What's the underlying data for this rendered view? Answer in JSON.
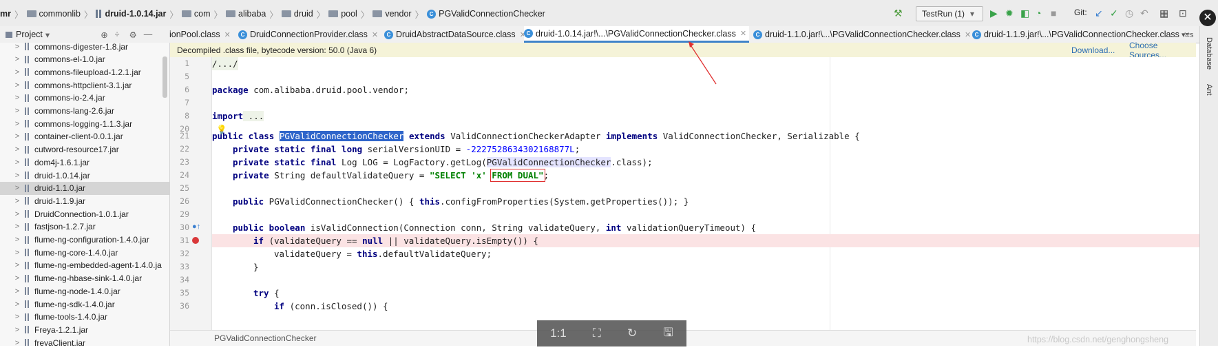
{
  "breadcrumb": [
    "mr",
    "commonlib",
    "druid-1.0.14.jar",
    "com",
    "alibaba",
    "druid",
    "pool",
    "vendor",
    "PGValidConnectionChecker"
  ],
  "toolbar": {
    "run_config": "TestRun (1)",
    "git_label": "Git:"
  },
  "project_header": {
    "label": "Project"
  },
  "tabs": [
    {
      "label": "ionPool.class",
      "active": false
    },
    {
      "label": "DruidConnectionProvider.class",
      "active": false
    },
    {
      "label": "DruidAbstractDataSource.class",
      "active": false
    },
    {
      "label": "druid-1.0.14.jar!\\...\\PGValidConnectionChecker.class",
      "active": true
    },
    {
      "label": "druid-1.1.0.jar!\\...\\PGValidConnectionChecker.class",
      "active": false
    },
    {
      "label": "druid-1.1.9.jar!\\...\\PGValidConnectionChecker.class",
      "active": false
    }
  ],
  "tabs_overflow": "▾≡s",
  "sidebar": {
    "items": [
      "commons-digester-1.8.jar",
      "commons-el-1.0.jar",
      "commons-fileupload-1.2.1.jar",
      "commons-httpclient-3.1.jar",
      "commons-io-2.4.jar",
      "commons-lang-2.6.jar",
      "commons-logging-1.1.3.jar",
      "container-client-0.0.1.jar",
      "cutword-resource17.jar",
      "dom4j-1.6.1.jar",
      "druid-1.0.14.jar",
      "druid-1.1.0.jar",
      "druid-1.1.9.jar",
      "DruidConnection-1.0.1.jar",
      "fastjson-1.2.7.jar",
      "flume-ng-configuration-1.4.0.jar",
      "flume-ng-core-1.4.0.jar",
      "flume-ng-embedded-agent-1.4.0.ja",
      "flume-ng-hbase-sink-1.4.0.jar",
      "flume-ng-node-1.4.0.jar",
      "flume-ng-sdk-1.4.0.jar",
      "flume-tools-1.4.0.jar",
      "Freya-1.2.1.jar",
      "freyaClient.jar"
    ],
    "selected": "druid-1.1.0.jar"
  },
  "infobar": {
    "message": "Decompiled .class file, bytecode version: 50.0 (Java 6)",
    "download": "Download...",
    "choose_sources": "Choose Sources..."
  },
  "code": {
    "line_numbers": [
      "1",
      "5",
      "6",
      "7",
      "8",
      "20",
      "21",
      "22",
      "23",
      "24",
      "25",
      "26",
      "29",
      "30",
      "31",
      "32",
      "33",
      "34",
      "35",
      "36"
    ],
    "l1": "/.../",
    "l6_kw": "package",
    "l6_rest": " com.alibaba.druid.pool.vendor;",
    "l8_kw": "import",
    "l8_rest": " ...",
    "l21_kw1": "public class",
    "l21_name": "PGValidConnectionChecker",
    "l21_kw2": "extends",
    "l21_mid": " ValidConnectionCheckerAdapter ",
    "l21_kw3": "implements",
    "l21_rest": " ValidConnectionChecker, Serializable {",
    "l22_kw": "private static final long",
    "l22_mid": " serialVersionUID = ",
    "l22_num": "-2227528634302168877L",
    "l22_end": ";",
    "l23_kw": "private static final",
    "l23_mid": " Log LOG = LogFactory.getLog(",
    "l23_ref": "PGValidConnectionChecker",
    "l23_end": ".class);",
    "l24_kw": "private",
    "l24_mid": " String defaultValidateQuery = ",
    "l24_str1": "\"SELECT 'x' ",
    "l24_str2": "FROM DUAL\"",
    "l24_end": ";",
    "l26_kw": "public",
    "l26_mid": " PGValidConnectionChecker() { ",
    "l26_kw2": "this",
    "l26_rest": ".configFromProperties(System.getProperties()); }",
    "l30_kw": "public boolean",
    "l30_mid": " isValidConnection(Connection conn, String validateQuery, ",
    "l30_kw2": "int",
    "l30_rest": " validationQueryTimeout) {",
    "l31_kw": "if",
    "l31_mid": " (validateQuery == ",
    "l31_kw2": "null",
    "l31_rest": " || validateQuery.isEmpty()) {",
    "l32_pre": "validateQuery = ",
    "l32_kw": "this",
    "l32_rest": ".defaultValidateQuery;",
    "l33": "}",
    "l35_kw": "try",
    "l35_rest": " {",
    "l36_kw": "if",
    "l36_rest": " (conn.isClosed()) {"
  },
  "right_strip": {
    "database": "Database",
    "ant": "Ant"
  },
  "status": {
    "file": "PGValidConnectionChecker"
  },
  "viewer": {
    "zoom": "1:1"
  },
  "watermark": "https://blog.csdn.net/genghongsheng",
  "colors": {
    "accent": "#4083c9",
    "keyword": "#000080",
    "string": "#008000",
    "breakpoint": "#d9383a",
    "annotation": "#e03030"
  }
}
